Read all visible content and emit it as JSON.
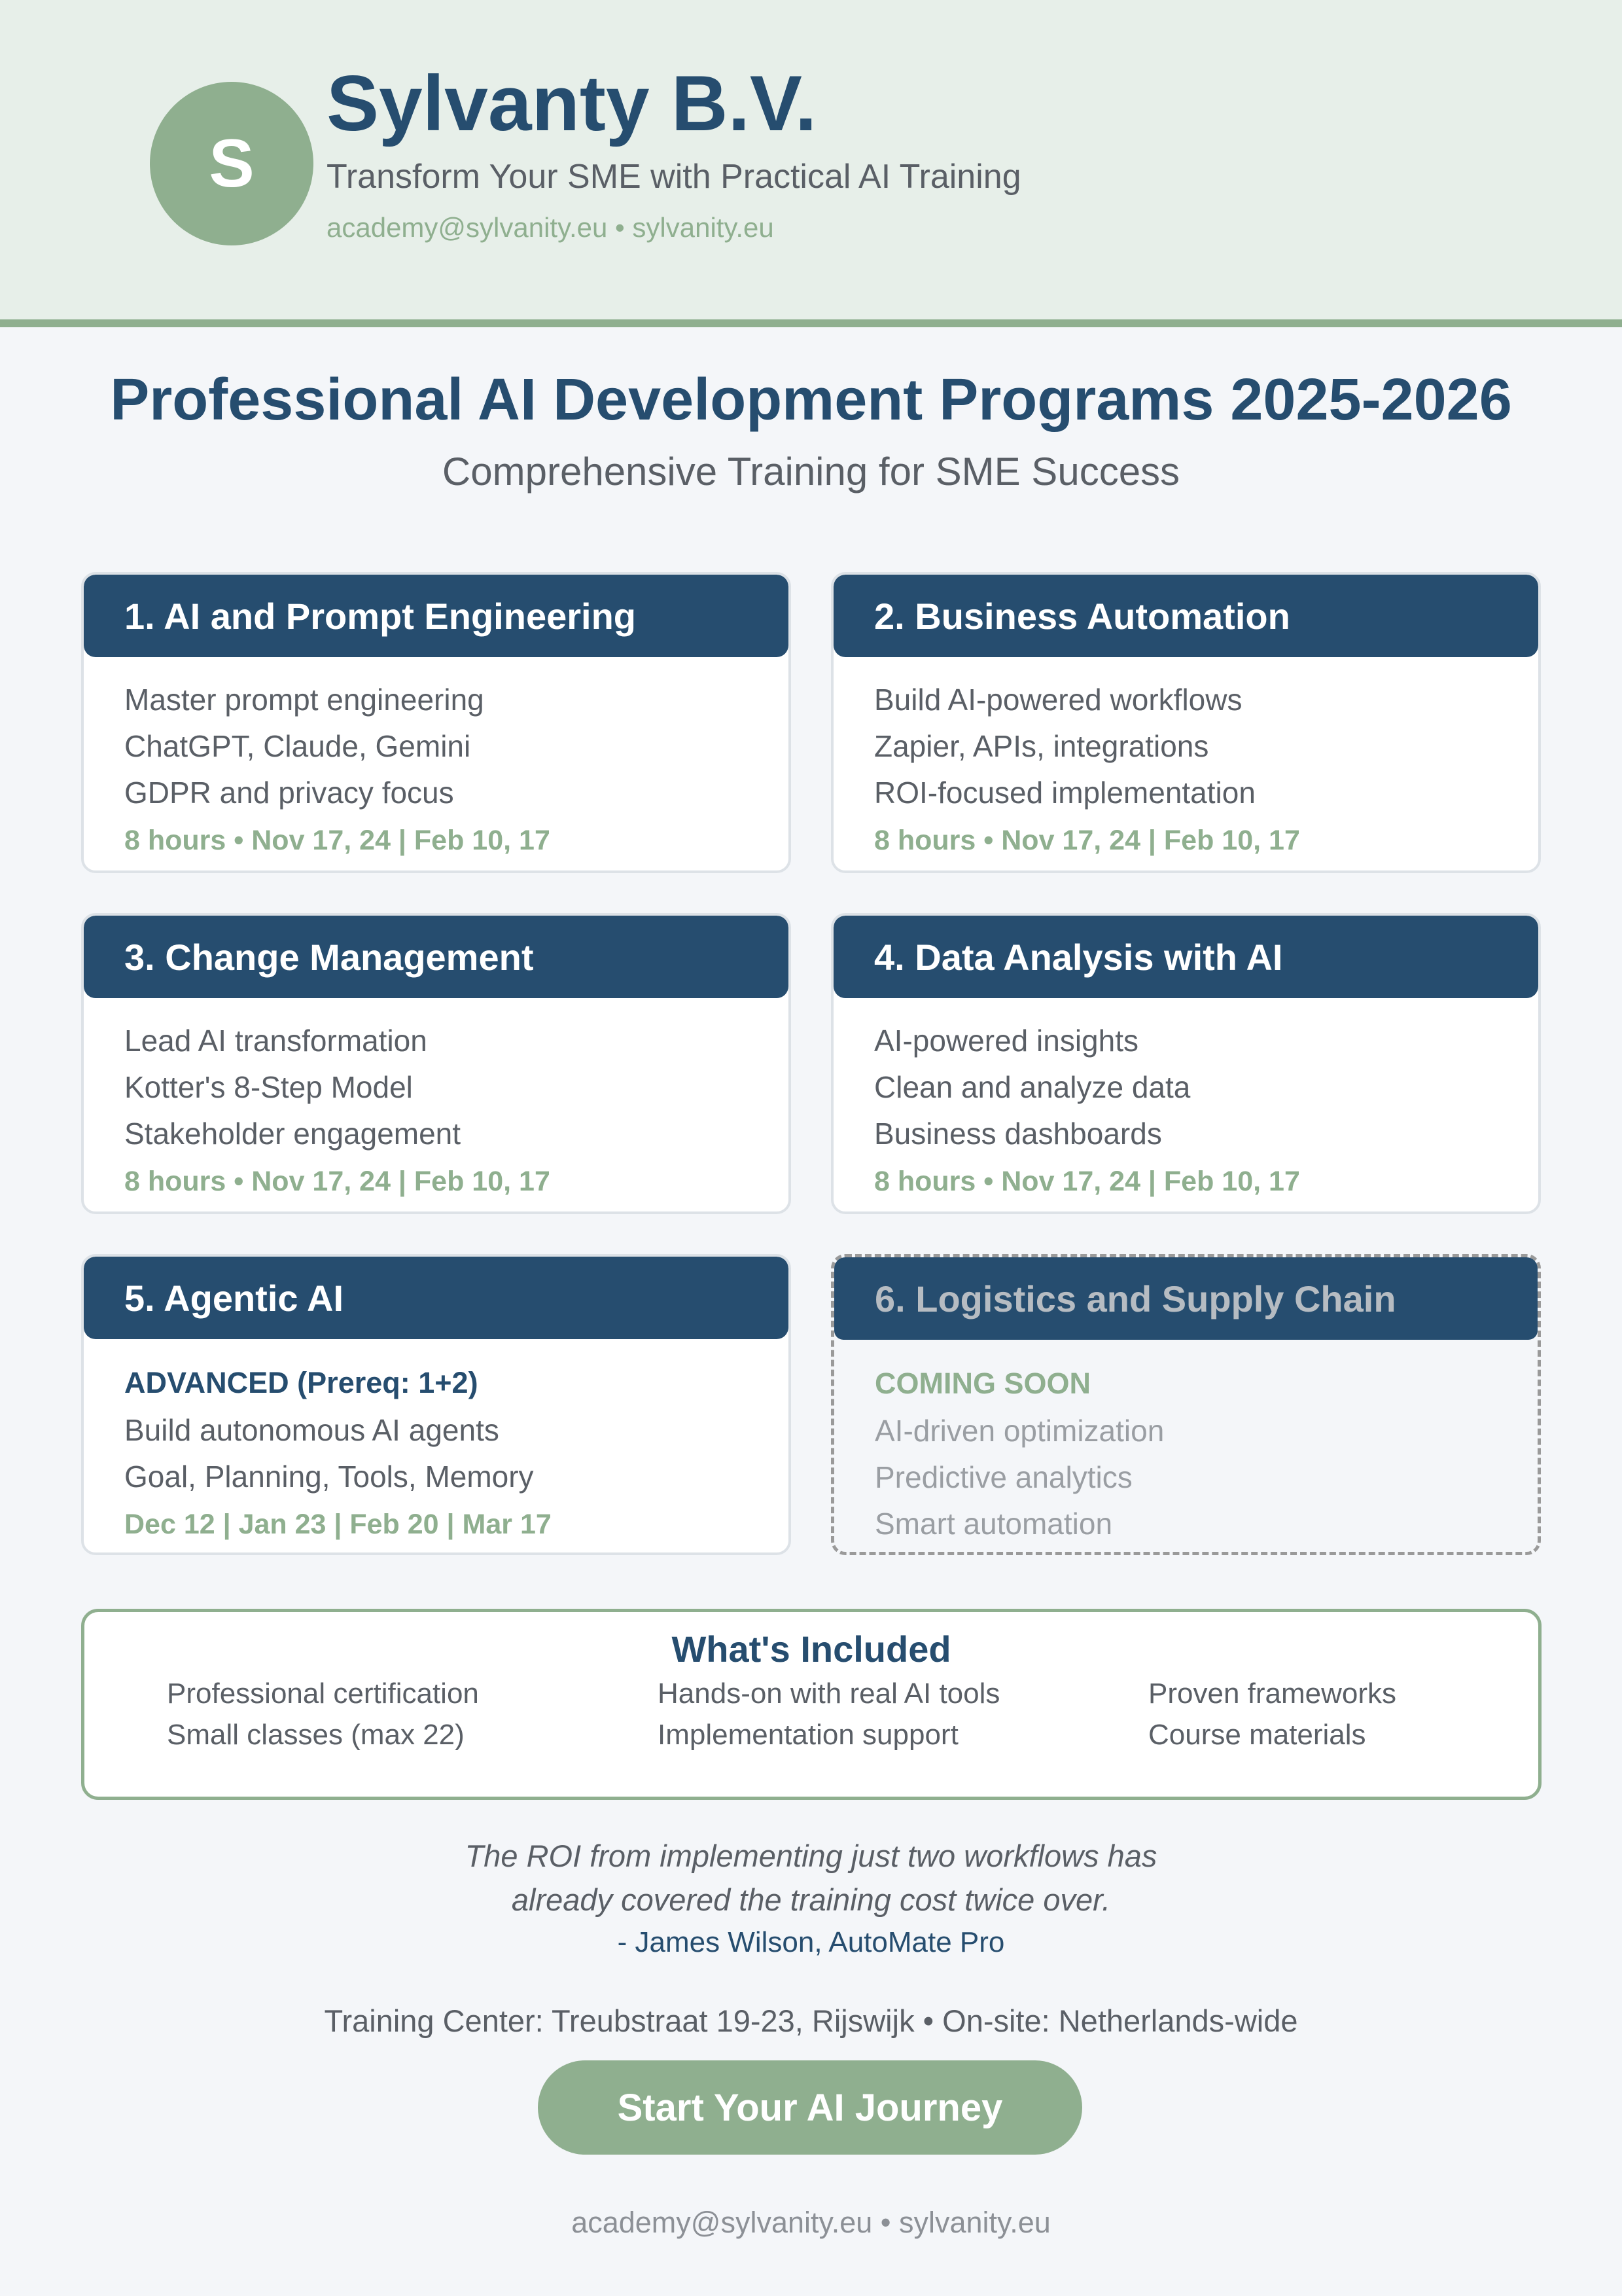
{
  "header": {
    "logo_letter": "S",
    "company": "Sylvanty B.V.",
    "tagline": "Transform Your SME with Practical AI Training",
    "contact": "academy@sylvanity.eu • sylvanity.eu"
  },
  "title": "Professional AI Development Programs 2025-2026",
  "subtitle": "Comprehensive Training for SME Success",
  "programs": [
    {
      "title": "1. AI and Prompt Engineering",
      "lines": [
        "Master prompt engineering",
        "ChatGPT, Claude, Gemini",
        "GDPR and privacy focus"
      ],
      "meta": "8 hours • Nov 17, 24 | Feb 10, 17"
    },
    {
      "title": "2. Business Automation",
      "lines": [
        "Build AI-powered workflows",
        "Zapier, APIs, integrations",
        "ROI-focused implementation"
      ],
      "meta": "8 hours • Nov 17, 24 | Feb 10, 17"
    },
    {
      "title": "3. Change Management",
      "lines": [
        "Lead AI transformation",
        "Kotter's 8-Step Model",
        "Stakeholder engagement"
      ],
      "meta": "8 hours • Nov 17, 24 | Feb 10, 17"
    },
    {
      "title": "4. Data Analysis with AI",
      "lines": [
        "AI-powered insights",
        "Clean and analyze data",
        "Business dashboards"
      ],
      "meta": "8 hours • Nov 17, 24 | Feb 10, 17"
    },
    {
      "title": "5. Agentic AI",
      "level": "ADVANCED (Prereq: 1+2)",
      "lines": [
        "Build autonomous AI agents",
        "Goal, Planning, Tools, Memory"
      ],
      "meta": "Dec 12 | Jan 23 | Feb 20 | Mar 17"
    },
    {
      "title": "6. Logistics and Supply Chain",
      "status": "COMING SOON",
      "lines": [
        "AI-driven optimization",
        "Predictive analytics",
        "Smart automation"
      ]
    }
  ],
  "included": {
    "title": "What's Included",
    "items": [
      "Professional certification",
      "Hands-on with real AI tools",
      "Proven frameworks",
      "Small classes (max 22)",
      "Implementation support",
      "Course materials"
    ]
  },
  "testimonial": {
    "quote_line1": "The ROI from implementing just two workflows has",
    "quote_line2": "already covered the training cost twice over.",
    "author": "- James Wilson, AutoMate Pro"
  },
  "location": "Training Center: Treubstraat 19-23, Rijswijk • On-site: Netherlands-wide",
  "cta_label": "Start Your AI Journey",
  "footer": "academy@sylvanity.eu • sylvanity.eu",
  "colors": {
    "navy": "#264d6f",
    "sage": "#8faf8f",
    "header_bg": "#e7efe9",
    "page_bg": "#f4f6f9"
  }
}
